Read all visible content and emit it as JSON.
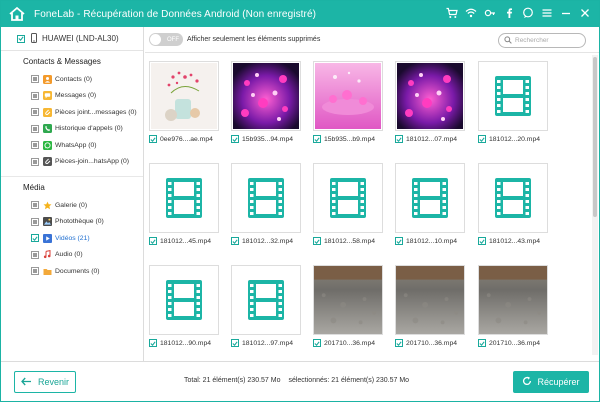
{
  "app": {
    "brand": "FoneLab",
    "title": "FoneLab - Récupération de Données Android (Non enregistré)"
  },
  "title_icons": [
    "cart-icon",
    "wifi-icon",
    "key-icon",
    "facebook-icon",
    "chat-icon",
    "menu-icon",
    "minimize-icon",
    "close-icon"
  ],
  "sidebar": {
    "device": "HUAWEI (LND-AL30)",
    "sections": [
      {
        "title": "Contacts & Messages",
        "items": [
          {
            "label": "Contacts (0)",
            "icon": "contacts-icon"
          },
          {
            "label": "Messages (0)",
            "icon": "messages-icon"
          },
          {
            "label": "Pièces joint...messages (0)",
            "icon": "attachment-icon"
          },
          {
            "label": "Historique d'appels (0)",
            "icon": "phone-icon"
          },
          {
            "label": "WhatsApp (0)",
            "icon": "whatsapp-icon"
          },
          {
            "label": "Pièces-join...hatsApp (0)",
            "icon": "whatsapp-attachment-icon"
          }
        ]
      },
      {
        "title": "Média",
        "items": [
          {
            "label": "Galerie (0)",
            "icon": "gallery-icon"
          },
          {
            "label": "Photothèque (0)",
            "icon": "photo-library-icon"
          },
          {
            "label": "Vidéos (21)",
            "icon": "video-icon",
            "active": true
          },
          {
            "label": "Audio (0)",
            "icon": "audio-icon"
          },
          {
            "label": "Documents (0)",
            "icon": "documents-icon"
          }
        ]
      }
    ]
  },
  "toolbar": {
    "toggle_label": "OFF",
    "filter_text": "Afficher seulement les éléments supprimés",
    "search_placeholder": "Rechercher"
  },
  "grid": {
    "items": [
      {
        "name": "0ee976....ae.mp4",
        "thumb": "flowers"
      },
      {
        "name": "15b935...94.mp4",
        "thumb": "hearts"
      },
      {
        "name": "15b935...b9.mp4",
        "thumb": "pink"
      },
      {
        "name": "181012...07.mp4",
        "thumb": "hearts"
      },
      {
        "name": "181012...20.mp4",
        "thumb": "film"
      },
      {
        "name": "181012...45.mp4",
        "thumb": "film"
      },
      {
        "name": "181012...32.mp4",
        "thumb": "film"
      },
      {
        "name": "181012...58.mp4",
        "thumb": "film"
      },
      {
        "name": "181012...10.mp4",
        "thumb": "film"
      },
      {
        "name": "181012...43.mp4",
        "thumb": "film"
      },
      {
        "name": "181012...90.mp4",
        "thumb": "film"
      },
      {
        "name": "181012...97.mp4",
        "thumb": "film"
      },
      {
        "name": "201710...36.mp4",
        "thumb": "floor"
      },
      {
        "name": "201710...36.mp4",
        "thumb": "floor"
      },
      {
        "name": "201710...36.mp4",
        "thumb": "floor"
      }
    ]
  },
  "footer": {
    "back_label": "Revenir",
    "total": "Total: 21 élément(s) 230.57 Mo",
    "selected": "sélectionnés: 21 élément(s) 230.57 Mo",
    "recover_label": "Récupérer"
  },
  "colors": {
    "accent": "#1cb5a6",
    "active_link": "#1f6fd1"
  }
}
